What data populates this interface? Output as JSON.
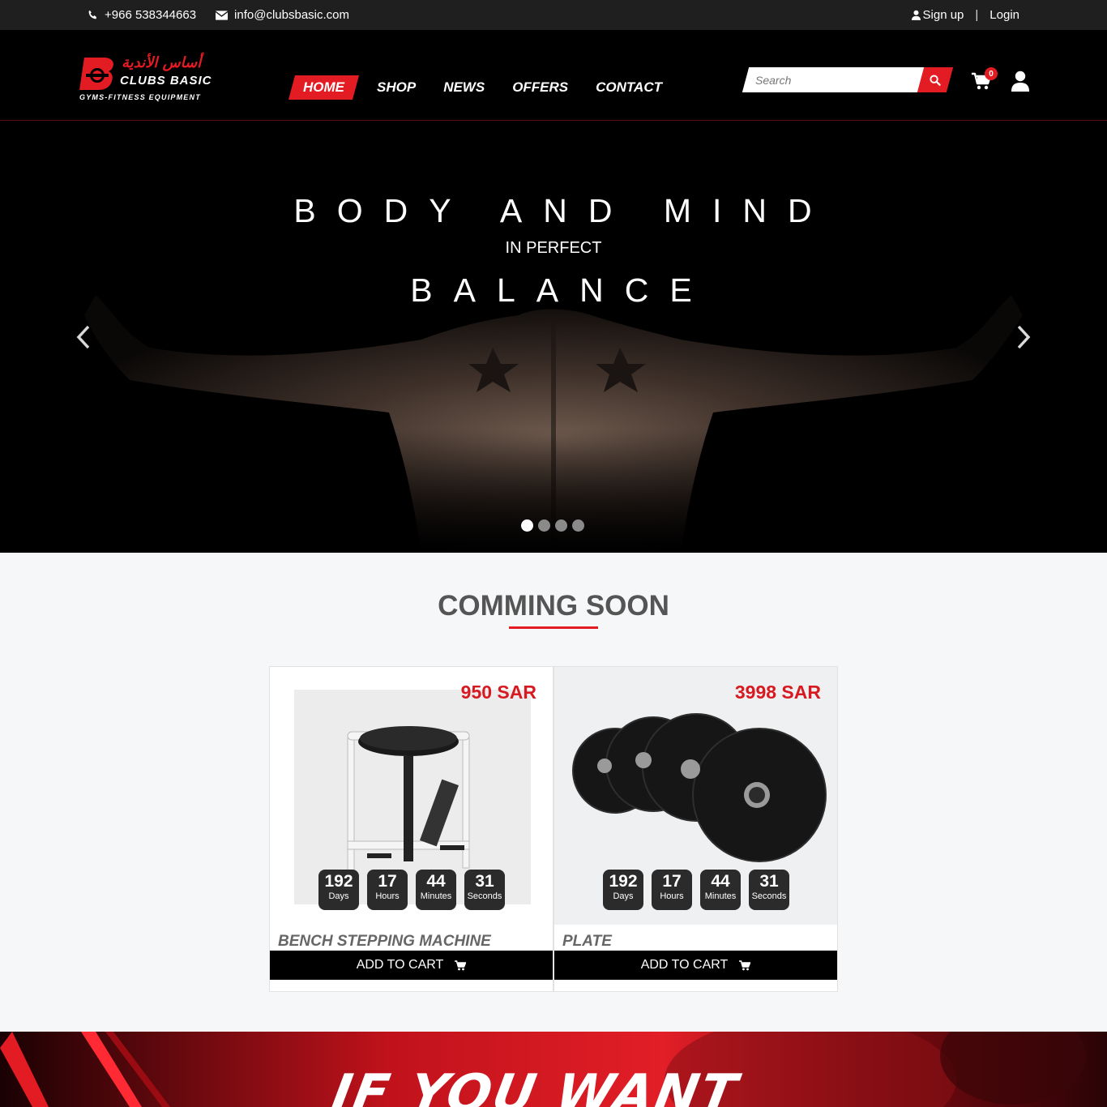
{
  "topbar": {
    "phone": "+966 538344663",
    "email": "info@clubsbasic.com",
    "signup": "Sign up",
    "separator": "|",
    "login": "Login"
  },
  "logo": {
    "arabic": "أساس الأندية",
    "name": "CLUBS BASIC",
    "tagline": "GYMS-FITNESS EQUIPMENT"
  },
  "nav": [
    {
      "label": "HOME",
      "active": true
    },
    {
      "label": "SHOP"
    },
    {
      "label": "NEWS"
    },
    {
      "label": "OFFERS"
    },
    {
      "label": "CONTACT"
    }
  ],
  "search": {
    "placeholder": "Search"
  },
  "cart": {
    "count": "0"
  },
  "hero": {
    "line1": "BODY AND MIND",
    "line2": "IN PERFECT",
    "line3": "BALANCE",
    "slides": 4,
    "active_slide": 1
  },
  "coming_soon": {
    "title": "COMMING SOON",
    "products": [
      {
        "price": "950 SAR",
        "name": "BENCH STEPPING MACHINE",
        "countdown": [
          {
            "value": "192",
            "unit": "Days"
          },
          {
            "value": "17",
            "unit": "Hours"
          },
          {
            "value": "44",
            "unit": "Minutes"
          },
          {
            "value": "31",
            "unit": "Seconds"
          }
        ],
        "button": "ADD TO CART"
      },
      {
        "price": "3998 SAR",
        "name": "PLATE",
        "countdown": [
          {
            "value": "192",
            "unit": "Days"
          },
          {
            "value": "17",
            "unit": "Hours"
          },
          {
            "value": "44",
            "unit": "Minutes"
          },
          {
            "value": "31",
            "unit": "Seconds"
          }
        ],
        "button": "ADD TO CART"
      }
    ]
  },
  "banner": {
    "text": "IF YOU WANT"
  },
  "colors": {
    "accent": "#e31b23",
    "dark": "#000000",
    "topbar": "#1f1f1f"
  }
}
